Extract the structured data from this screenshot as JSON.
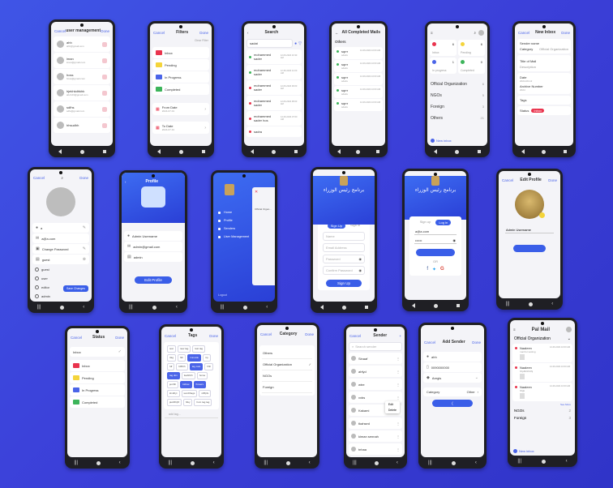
{
  "p1": {
    "cancel": "Cancel",
    "title": "user management",
    "done": "Done",
    "users": [
      {
        "name": "ahh",
        "email": "ahh@gmail.com"
      },
      {
        "name": "iman",
        "email": "iman@gmail.com"
      },
      {
        "name": "hoss",
        "email": "hoss@gmail.com"
      },
      {
        "name": "hjekhkdhkhk",
        "email": "abc123@gmail.com"
      },
      {
        "name": "sdfhs",
        "email": "sdfs@gmail.com"
      },
      {
        "name": "hhsudhh",
        "email": ""
      }
    ]
  },
  "p2": {
    "cancel": "Cancel",
    "title": "Filters",
    "done": "Done",
    "clear": "Clear Filter",
    "statuses": [
      {
        "label": "Inbox",
        "color": "#e9334d"
      },
      {
        "label": "Pending",
        "color": "#f4d43a"
      },
      {
        "label": "In Progress",
        "color": "#4a64e8"
      },
      {
        "label": "Completed",
        "color": "#3cb45a"
      }
    ],
    "from_label": "From Date",
    "from_val": "2024-07-01",
    "to_label": "To Date",
    "to_val": "2024-07-31"
  },
  "p3": {
    "back": "‹",
    "title": "Search",
    "query": "sadat",
    "results": [
      {
        "name": "mohammed sader",
        "date": "12-06-2024 10:30 AM",
        "color": "#3cb45a"
      },
      {
        "name": "mohammed sader",
        "date": "12-06-2024 11:00 AM",
        "color": "#3cb45a"
      },
      {
        "name": "mohammed sader",
        "date": "12-06-2024 09:00 AM",
        "color": "#e9334d"
      },
      {
        "name": "mohammed sader",
        "date": "12-06-2024 08:00 AM",
        "color": "#e9334d"
      },
      {
        "name": "mohammed sader hos",
        "date": "12-06-2024 07:00 AM",
        "color": "#e9334d"
      },
      {
        "name": "sadra",
        "date": "",
        "color": "#e9334d"
      }
    ]
  },
  "p4": {
    "back": "←",
    "title": "All Completed Mails",
    "section": "Others",
    "mails": [
      {
        "name": "sqrrr",
        "sub": "sdsds",
        "date": "12-06-2024 10:00 AM"
      },
      {
        "name": "sqrrr",
        "sub": "sdsds",
        "date": "12-06-2024 10:00 AM"
      },
      {
        "name": "sqrrr",
        "sub": "sdsds",
        "date": "12-06-2024 10:00 AM"
      },
      {
        "name": "sqrrr",
        "sub": "sdsds",
        "date": "12-06-2024 10:00 AM"
      },
      {
        "name": "sqrrr",
        "sub": "sdsds",
        "date": "12-06-2024 10:00 AM"
      }
    ]
  },
  "p5": {
    "tiles": [
      {
        "label": "Inbox",
        "count": "6",
        "color": "#e9334d"
      },
      {
        "label": "Pending",
        "count": "6",
        "color": "#f4d43a"
      },
      {
        "label": "In progress",
        "count": "1",
        "color": "#4a64e8"
      },
      {
        "label": "Completed",
        "count": "0",
        "color": "#3cb45a"
      }
    ],
    "cats": [
      {
        "label": "Official Organization",
        "count": "6"
      },
      {
        "label": "NGOs",
        "count": "5"
      },
      {
        "label": "Foreign",
        "count": "3"
      },
      {
        "label": "Others",
        "count": "21"
      }
    ],
    "fab": "New inbox"
  },
  "p6": {
    "cancel": "Cancel",
    "title": "New Inbox",
    "done": "Done",
    "sender": "Sender name",
    "category_label": "Category",
    "category_val": "Official Organization",
    "title_field": "Title of Mail",
    "desc_field": "Description",
    "date_label": "Date",
    "date_val": "2024-06-12",
    "archive_label": "Archive Number",
    "archive_val": "2024",
    "tags_label": "Tags",
    "status_label": "Status",
    "status_val": "Inbox"
  },
  "p7": {
    "cancel": "Cancel",
    "done": "Done",
    "name": "a",
    "email": "a@a.com",
    "change_pw": "Change Password",
    "role": "guest",
    "roles": [
      "guest",
      "user",
      "editor",
      "admin"
    ],
    "save": "Save Changes"
  },
  "p8": {
    "back": "‹",
    "title": "Profile",
    "name": "Admin Username",
    "email": "admin@gmail.com",
    "role": "admin",
    "edit": "Edit Profile"
  },
  "p9": {
    "menu": [
      {
        "label": "Home",
        "icon": "home-icon"
      },
      {
        "label": "Profile",
        "icon": "person-icon"
      },
      {
        "label": "Senders",
        "icon": "group-icon"
      },
      {
        "label": "User Management",
        "icon": "people-icon"
      }
    ],
    "logout": "Logout",
    "peek": "Official Organ..."
  },
  "p10": {
    "tab_up": "Sign Up",
    "tab_in": "Sign in",
    "fields": [
      "Name",
      "Email Address",
      "Password",
      "Confirm Password"
    ],
    "btn": "Sign Up",
    "ar_title": "ﺑﺮﻧﺎﻣﺞ ﺭﺋﻴﺲ ﺍﻟﻮﺯﺭﺍﺀ"
  },
  "p11": {
    "tab_up": "Sign up",
    "tab_in": "Log in",
    "email": "a@a.com",
    "password": "••••••",
    "or": "OR",
    "ar_title": "ﺑﺮﻧﺎﻣﺞ ﺭﺋﻴﺲ ﺍﻟﻮﺯﺭﺍﺀ"
  },
  "p12": {
    "cancel": "Cancel",
    "title": "Edit Profile",
    "done": "Done",
    "name": "Admin Username"
  },
  "p13": {
    "cancel": "Cancel",
    "title": "Status",
    "done": "Done",
    "statuses": [
      {
        "label": "Inbox",
        "color": "#e9334d"
      },
      {
        "label": "Pending",
        "color": "#f4d43a"
      },
      {
        "label": "In Progress",
        "color": "#4a64e8"
      },
      {
        "label": "Completed",
        "color": "#3cb45a"
      }
    ],
    "inbox_top": "Inbox"
  },
  "p14": {
    "cancel": "Cancel",
    "title": "Tags",
    "done": "Done",
    "tags": [
      {
        "t": "test",
        "on": false
      },
      {
        "t": "new tag",
        "on": false
      },
      {
        "t": "last tag",
        "on": false
      },
      {
        "t": "ttag",
        "on": false
      },
      {
        "t": "fkh",
        "on": false
      },
      {
        "t": "rmnotok",
        "on": true
      },
      {
        "t": "my",
        "on": false
      },
      {
        "t": "fdf",
        "on": false
      },
      {
        "t": "fdfhhh",
        "on": false
      },
      {
        "t": "tag cats",
        "on": true
      },
      {
        "t": "hhh",
        "on": false
      },
      {
        "t": "tag dim",
        "on": true
      },
      {
        "t": "feahhhh",
        "on": false
      },
      {
        "t": "home",
        "on": false
      },
      {
        "t": "jenthh",
        "on": false
      },
      {
        "t": "kidlow",
        "on": true
      },
      {
        "t": "flowers",
        "on": true
      },
      {
        "t": "kindhyt",
        "on": false
      },
      {
        "t": "wordthags",
        "on": false
      },
      {
        "t": "shffpfu",
        "on": false
      },
      {
        "t": "jaubffnjhf",
        "on": false
      },
      {
        "t": "fkky",
        "on": false
      },
      {
        "t": "hum tag tag",
        "on": false
      }
    ],
    "add": "add tag..."
  },
  "p15": {
    "cancel": "Cancel",
    "title": "Category",
    "done": "Done",
    "items": [
      "Others",
      "Official Organization",
      "NGOs",
      "Foreign"
    ]
  },
  "p16": {
    "cancel": "Cancel",
    "title": "Sender",
    "search": "Search sender",
    "senders": [
      "Sinaaf",
      "ahfyd",
      "wtre",
      "vvbs",
      "Kakami",
      "tkahsed",
      "kiman sennah",
      "tnhaa"
    ],
    "popup": [
      "Edit",
      "Delete"
    ]
  },
  "p17": {
    "cancel": "Cancel",
    "title": "Add Sender",
    "done": "Done",
    "name": "ahh",
    "phone": "0090000000",
    "sel": "Aregis",
    "category_label": "Category",
    "category_val": "Other",
    "btn": "Done"
  },
  "p18": {
    "title": "Pal Mail",
    "section": "Official Organization",
    "mails": [
      {
        "name": "Naaleen",
        "sub": "mail for testing",
        "date": "12-06-2024 10:00 AM"
      },
      {
        "name": "Naaleen",
        "sub": "hhjdfkhhfdhj",
        "date": "12-06-2024 10:00 AM"
      },
      {
        "name": "Naaleen",
        "sub": "hhjjk",
        "date": "12-06-2024 10:00 AM"
      }
    ],
    "seemore": "See More",
    "ngos": "NGOs",
    "ngos_count": "2",
    "foreign": "Foreign",
    "foreign_count": "3",
    "fab": "New inbox"
  }
}
